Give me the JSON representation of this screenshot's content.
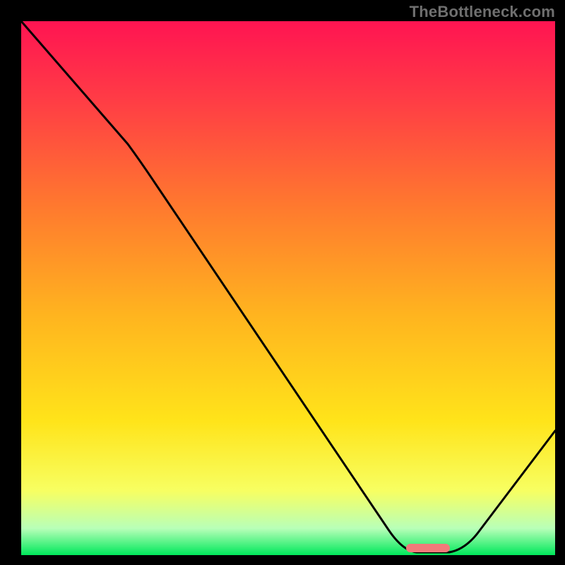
{
  "watermark": "TheBottleneck.com",
  "chart_data": {
    "type": "line",
    "title": "",
    "xlabel": "",
    "ylabel": "",
    "xlim": [
      0,
      100
    ],
    "ylim": [
      0,
      100
    ],
    "x": [
      0,
      20,
      72,
      80,
      100
    ],
    "values": [
      100,
      77,
      0,
      0,
      23
    ],
    "series": [
      {
        "name": "bottleneck-curve",
        "values": [
          100,
          77,
          0,
          0,
          23
        ]
      }
    ],
    "optimal_range": {
      "start": 72,
      "end": 80
    },
    "background_gradient": {
      "top": "#ff1452",
      "mid_high": "#ff7a2e",
      "mid": "#ffe41a",
      "low": "#00e85b"
    }
  },
  "marker": {
    "left_pct": 72,
    "right_pct": 80,
    "color": "#f27a7a"
  }
}
